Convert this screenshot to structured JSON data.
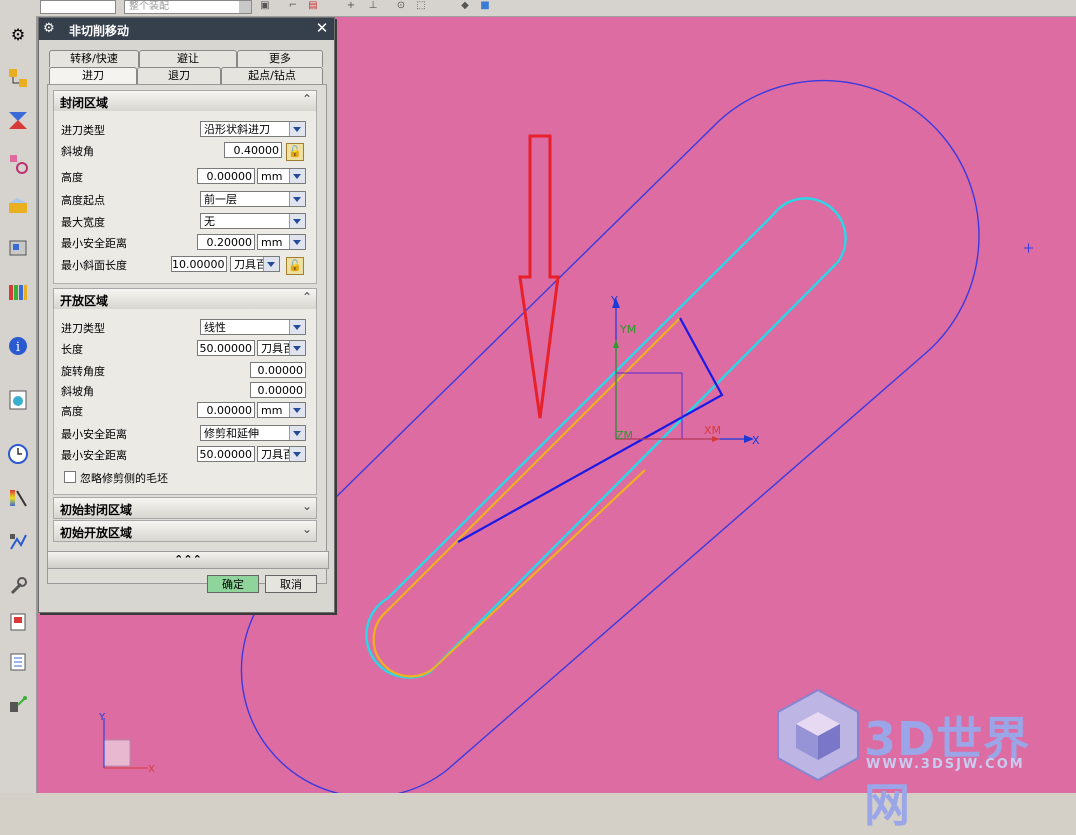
{
  "toolbar": {
    "combo1": "",
    "combo2": "整个装配"
  },
  "dialog": {
    "title": "非切削移动",
    "tabs_row1": [
      "转移/快速",
      "避让",
      "更多"
    ],
    "tabs_row2": [
      "进刀",
      "退刀",
      "起点/钻点"
    ],
    "active_tab": "进刀",
    "closed_section": {
      "title": "封闭区域",
      "rows": [
        {
          "label": "进刀类型",
          "value": "沿形状斜进刀"
        },
        {
          "label": "斜坡角",
          "value": "0.40000"
        },
        {
          "label": "高度",
          "value": "0.00000",
          "unit": "mm"
        },
        {
          "label": "高度起点",
          "value": "前一层"
        },
        {
          "label": "最大宽度",
          "value": "无"
        },
        {
          "label": "最小安全距离",
          "value": "0.20000",
          "unit": "mm"
        },
        {
          "label": "最小斜面长度",
          "value": "10.00000",
          "unit": "刀具百"
        }
      ]
    },
    "open_section": {
      "title": "开放区域",
      "rows": [
        {
          "label": "进刀类型",
          "value": "线性"
        },
        {
          "label": "长度",
          "value": "50.00000",
          "unit": "刀具百"
        },
        {
          "label": "旋转角度",
          "value": "0.00000"
        },
        {
          "label": "斜坡角",
          "value": "0.00000"
        },
        {
          "label": "高度",
          "value": "0.00000",
          "unit": "mm"
        },
        {
          "label": "最小安全距离",
          "value": "修剪和延伸"
        },
        {
          "label": "最小安全距离",
          "value": "50.00000",
          "unit": "刀具百"
        }
      ],
      "checkbox_label": "忽略修剪侧的毛坯"
    },
    "initial_closed": "初始封闭区域",
    "initial_open": "初始开放区域",
    "collapse_glyph": "⌃⌃⌃",
    "ok_label": "确定",
    "cancel_label": "取消"
  },
  "scene": {
    "axis_labels": {
      "y": "Y",
      "ym": "YM",
      "zm": "ZM",
      "xm": "XM",
      "x": "X"
    },
    "corner_triad": {
      "y": "Y",
      "x": "X"
    }
  },
  "watermark": {
    "text": "3D世界网",
    "url": "WWW.3DSJW.COM"
  },
  "colors": {
    "background": "#dc6ca2",
    "dialog_title": "#35404c",
    "ok_button": "#8fd49a",
    "outer_boundary": "#3a3ae0",
    "tool_path_cyan": "#2ad8e8",
    "tool_path_orange": "#f0b020",
    "arrow_red": "#e8202a"
  }
}
